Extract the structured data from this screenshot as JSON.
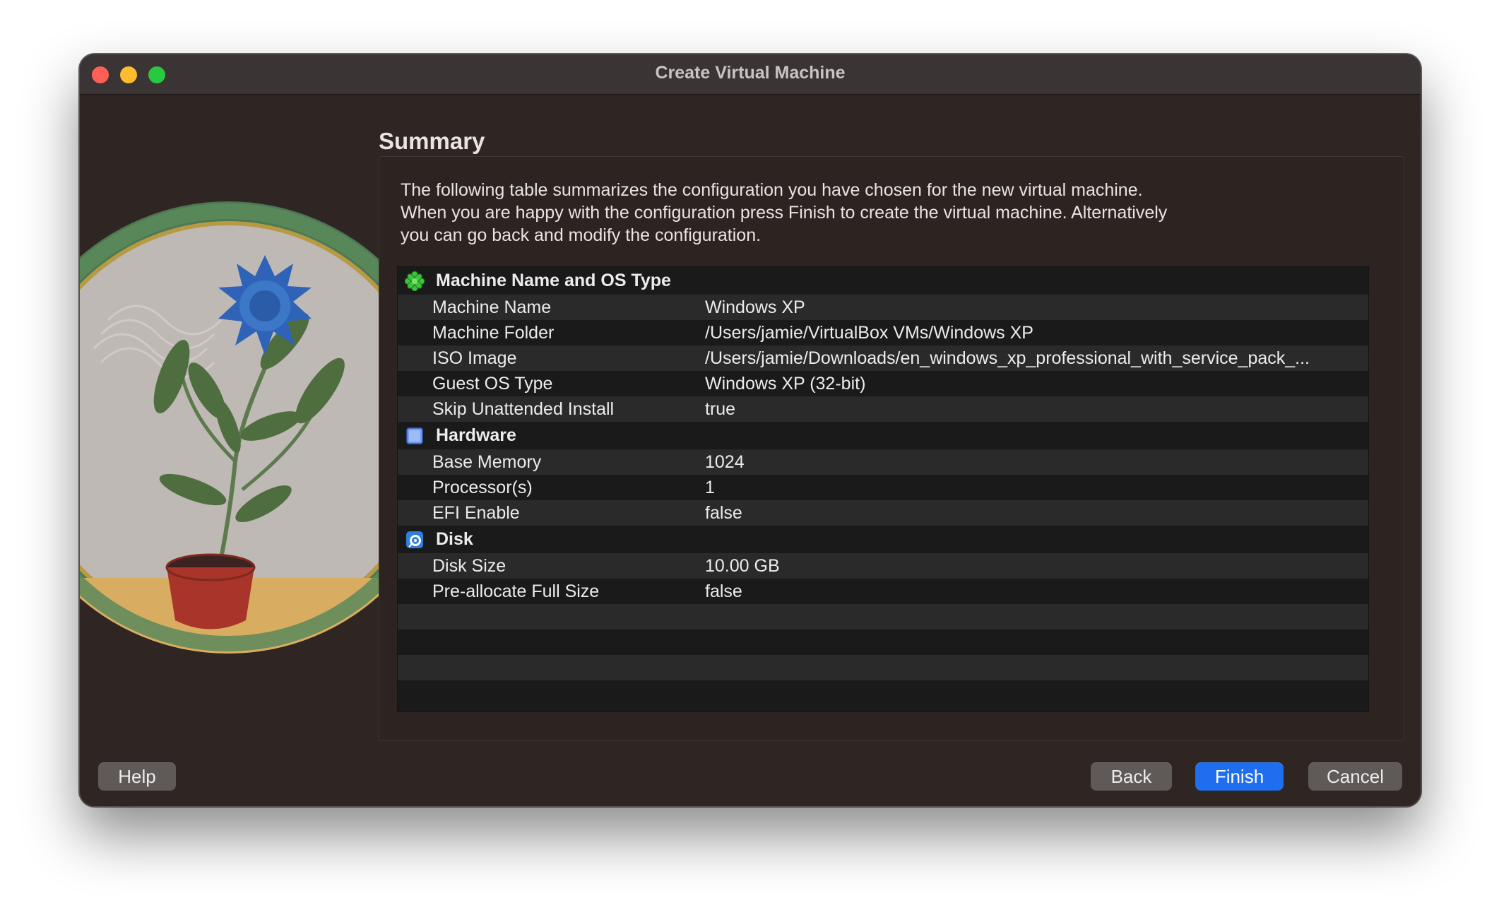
{
  "window": {
    "title": "Create Virtual Machine"
  },
  "page": {
    "heading": "Summary",
    "description": [
      "The following table summarizes the configuration you have chosen for the new virtual machine.",
      "When you are happy with the configuration press Finish to create the virtual machine. Alternatively",
      "you can go back and modify the configuration."
    ]
  },
  "sections": [
    {
      "title": "Machine Name and OS Type",
      "icon": "green-star-icon",
      "rows": [
        {
          "key": "Machine Name",
          "value": "Windows XP"
        },
        {
          "key": "Machine Folder",
          "value": "/Users/jamie/VirtualBox VMs/Windows XP"
        },
        {
          "key": "ISO Image",
          "value": "/Users/jamie/Downloads/en_windows_xp_professional_with_service_pack_..."
        },
        {
          "key": "Guest OS Type",
          "value": "Windows XP (32-bit)"
        },
        {
          "key": "Skip Unattended Install",
          "value": "true"
        }
      ]
    },
    {
      "title": "Hardware",
      "icon": "chip-icon",
      "rows": [
        {
          "key": "Base Memory",
          "value": "1024"
        },
        {
          "key": "Processor(s)",
          "value": "1"
        },
        {
          "key": "EFI Enable",
          "value": "false"
        }
      ]
    },
    {
      "title": "Disk",
      "icon": "disk-icon",
      "rows": [
        {
          "key": "Disk Size",
          "value": "10.00 GB"
        },
        {
          "key": "Pre-allocate Full Size",
          "value": "false"
        }
      ]
    }
  ],
  "buttons": {
    "help": "Help",
    "back": "Back",
    "finish": "Finish",
    "cancel": "Cancel"
  },
  "colors": {
    "accent": "#1f6ef0",
    "window_bg": "#2f2624",
    "table_bg": "#1a1a1a",
    "row_alt": "#2a2a2a"
  }
}
